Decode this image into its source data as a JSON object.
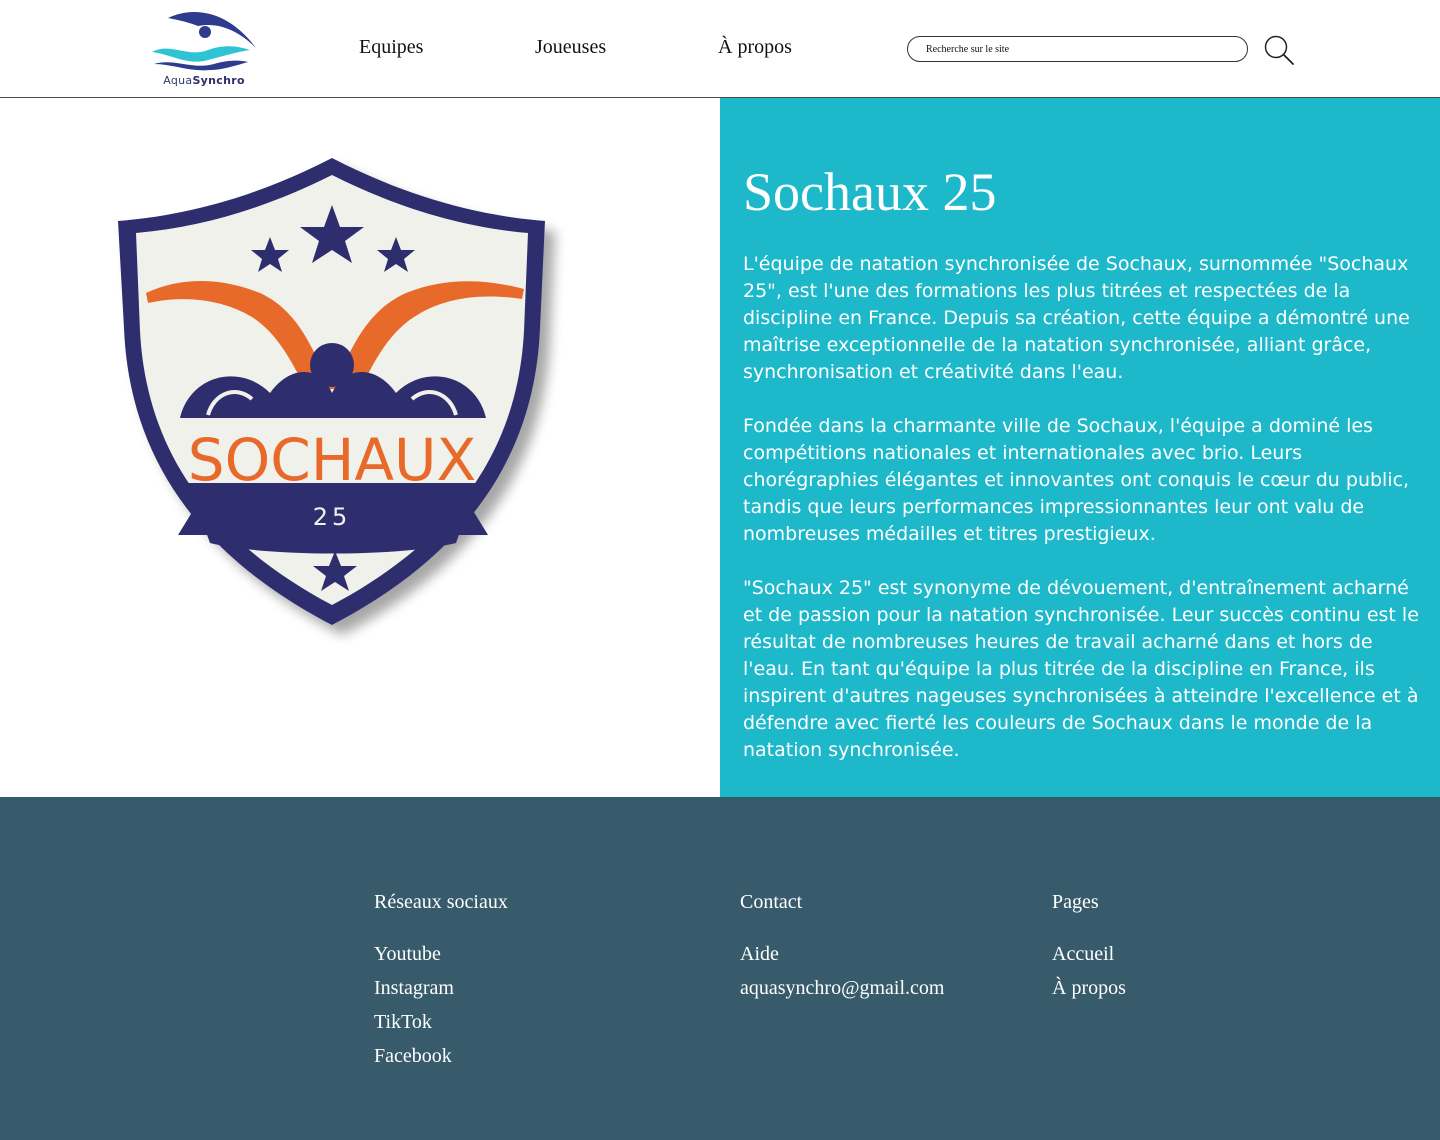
{
  "header": {
    "logo": {
      "text_aqua": "Aqua",
      "text_synchro": "Synchro"
    },
    "nav": [
      {
        "label": "Equipes"
      },
      {
        "label": "Joueuses"
      },
      {
        "label": "À propos"
      }
    ],
    "search": {
      "placeholder": "Recherche sur le site",
      "icon": "search-icon"
    }
  },
  "team": {
    "crest": {
      "name_text": "SOCHAUX",
      "number_text": "25"
    },
    "title": "Sochaux 25",
    "paragraphs": [
      "L'équipe de natation synchronisée de Sochaux, surnommée \"Sochaux 25\", est l'une des formations les plus titrées et respectées de la discipline en France. Depuis sa création, cette équipe a démontré une maîtrise exceptionnelle de la natation synchronisée, alliant grâce, synchronisation et créativité dans l'eau.",
      "Fondée dans la charmante ville de Sochaux, l'équipe a dominé les compétitions nationales et internationales avec brio. Leurs chorégraphies élégantes et innovantes ont conquis le cœur du public, tandis que leurs performances impressionnantes leur ont valu de nombreuses médailles et titres prestigieux.",
      "\"Sochaux 25\" est synonyme de dévouement, d'entraînement acharné et de passion pour la natation synchronisée. Leur succès continu est le résultat de nombreuses heures de travail acharné dans et hors de l'eau. En tant qu'équipe la plus titrée de la discipline en France, ils inspirent d'autres nageuses synchronisées à atteindre l'excellence et à défendre avec fierté les couleurs de Sochaux dans le monde de la natation synchronisée."
    ]
  },
  "footer": {
    "social": {
      "title": "Réseaux sociaux",
      "links": [
        "Youtube",
        "Instagram",
        "TikTok",
        "Facebook"
      ]
    },
    "contact": {
      "title": "Contact",
      "links": [
        "Aide",
        "aquasynchro@gmail.com"
      ]
    },
    "pages": {
      "title": "Pages",
      "links": [
        "Accueil",
        "À propos"
      ]
    }
  },
  "colors": {
    "accent_cyan": "#1eb8cb",
    "footer_bg": "#385b6c",
    "navy": "#2e2d6e",
    "orange": "#e86a2a"
  }
}
